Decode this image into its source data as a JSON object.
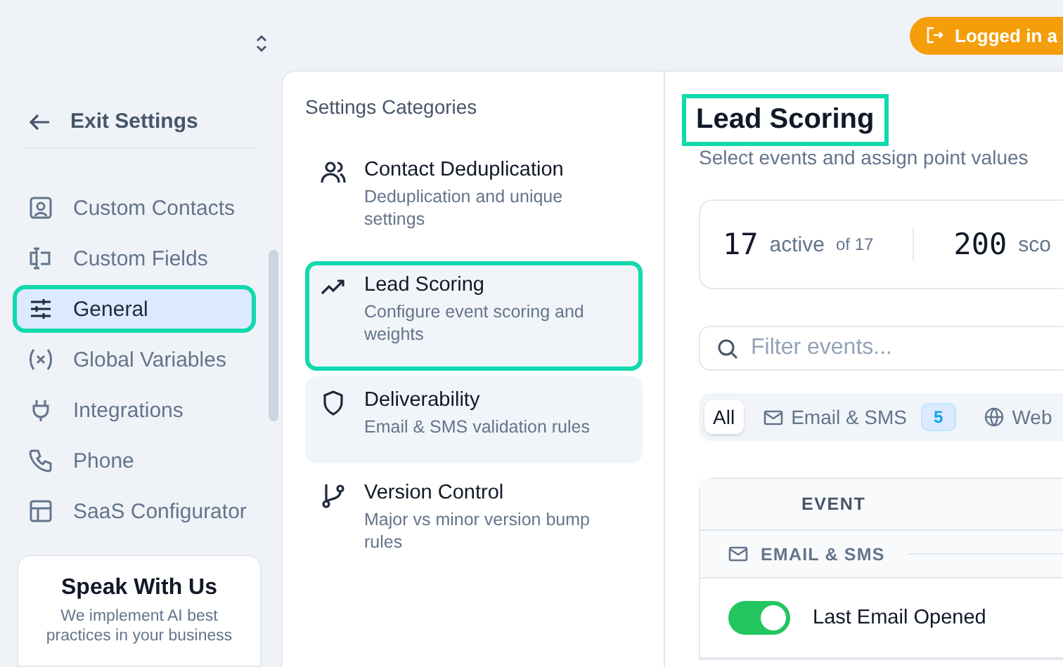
{
  "topbar": {
    "login_badge": "Logged in a"
  },
  "sidebar": {
    "exit": "Exit Settings",
    "items": [
      {
        "label": "Custom Contacts",
        "selected": false,
        "highlighted": false
      },
      {
        "label": "Custom Fields",
        "selected": false,
        "highlighted": false
      },
      {
        "label": "General",
        "selected": true,
        "highlighted": true
      },
      {
        "label": "Global Variables",
        "selected": false,
        "highlighted": false
      },
      {
        "label": "Integrations",
        "selected": false,
        "highlighted": false
      },
      {
        "label": "Phone",
        "selected": false,
        "highlighted": false
      },
      {
        "label": "SaaS Configurator",
        "selected": false,
        "highlighted": false
      }
    ],
    "promo": {
      "title": "Speak With Us",
      "text": "We implement AI best practices in your business"
    }
  },
  "categories": {
    "heading": "Settings Categories",
    "items": [
      {
        "title": "Contact Deduplication",
        "description": "Deduplication and unique settings",
        "selected": false,
        "hovered": false,
        "highlighted": false
      },
      {
        "title": "Lead Scoring",
        "description": "Configure event scoring and weights",
        "selected": true,
        "hovered": false,
        "highlighted": true
      },
      {
        "title": "Deliverability",
        "description": "Email & SMS validation rules",
        "selected": false,
        "hovered": true,
        "highlighted": false
      },
      {
        "title": "Version Control",
        "description": "Major vs minor version bump rules",
        "selected": false,
        "hovered": false,
        "highlighted": false
      }
    ]
  },
  "main": {
    "title": "Lead Scoring",
    "title_highlighted": true,
    "subtitle": "Select events and assign point values",
    "stats": [
      {
        "value": "17",
        "label": "active",
        "extra": "of 17"
      },
      {
        "value": "200",
        "label": "sco"
      }
    ],
    "search": {
      "placeholder": "Filter events..."
    },
    "filters": [
      {
        "label": "All",
        "kind": "plain",
        "selected": true
      },
      {
        "label": "Email & SMS",
        "kind": "mail",
        "count": "5",
        "selected": false
      },
      {
        "label": "Web",
        "kind": "globe",
        "selected": false
      }
    ],
    "table": {
      "columns": [
        "EVENT"
      ],
      "groups": [
        {
          "name": "EMAIL & SMS",
          "rows": [
            {
              "event": "Last Email Opened",
              "on": true
            }
          ]
        }
      ]
    }
  }
}
